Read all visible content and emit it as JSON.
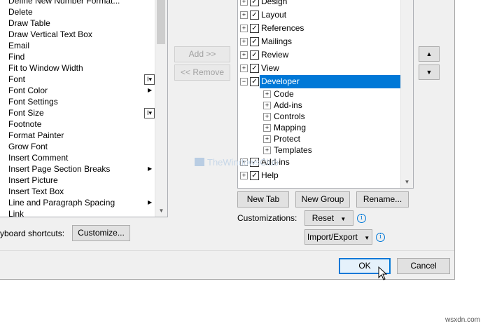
{
  "commands": {
    "items": [
      "Define New Number Format...",
      "Delete",
      "Draw Table",
      "Draw Vertical Text Box",
      "Email",
      "Find",
      "Fit to Window Width",
      "Font",
      "Font Color",
      "Font Settings",
      "Font Size",
      "Footnote",
      "Format Painter",
      "Grow Font",
      "Insert Comment",
      "Insert Page  Section Breaks",
      "Insert Picture",
      "Insert Text Box",
      "Line and Paragraph Spacing",
      "Link"
    ]
  },
  "middle": {
    "add_label": "Add >>",
    "remove_label": "<< Remove"
  },
  "tabs_tree": {
    "items": [
      {
        "label": "Design",
        "checked": true
      },
      {
        "label": "Layout",
        "checked": true
      },
      {
        "label": "References",
        "checked": true
      },
      {
        "label": "Mailings",
        "checked": true
      },
      {
        "label": "Review",
        "checked": true
      },
      {
        "label": "View",
        "checked": true
      },
      {
        "label": "Developer",
        "checked": true,
        "selected": true
      },
      {
        "label": "Code"
      },
      {
        "label": "Add-ins"
      },
      {
        "label": "Controls"
      },
      {
        "label": "Mapping"
      },
      {
        "label": "Protect"
      },
      {
        "label": "Templates"
      },
      {
        "label": "Add-ins",
        "checked": true
      },
      {
        "label": "Help",
        "checked": true
      }
    ]
  },
  "tree_buttons": {
    "new_tab": "New Tab",
    "new_group": "New Group",
    "rename": "Rename..."
  },
  "customizations": {
    "label": "Customizations:",
    "reset": "Reset",
    "import_export": "Import/Export"
  },
  "keyboard": {
    "label": "yboard shortcuts:",
    "customize": "Customize..."
  },
  "footer": {
    "ok": "OK",
    "cancel": "Cancel"
  },
  "watermark": {
    "text": "TheWindowsClub"
  },
  "site_tag": {
    "text": "wsxdn.com"
  },
  "colors": {
    "selection": "#0078d7",
    "dialog_bg": "#f0f0f0",
    "default_button_border": "#0078d7"
  }
}
